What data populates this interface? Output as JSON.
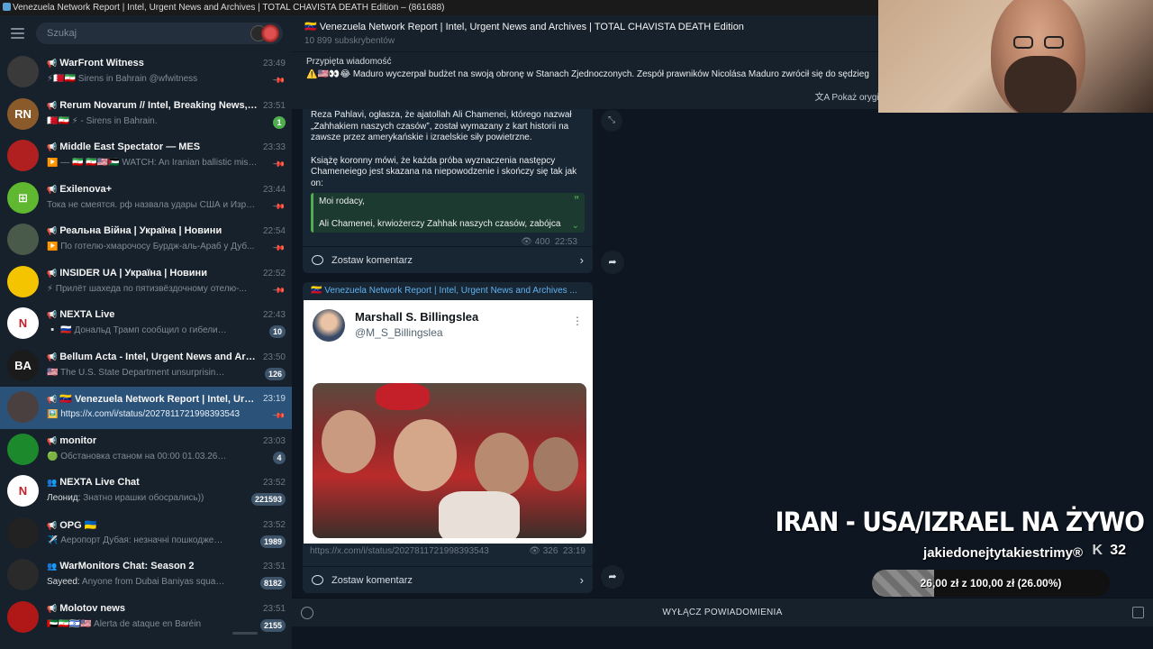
{
  "window": {
    "title": "Venezuela Network Report | Intel, Urgent News and Archives | TOTAL CHAVISTA DEATH Edition – (861688)"
  },
  "sidebar": {
    "search_placeholder": "Szukaj",
    "chats": [
      {
        "name": "WarFront Witness",
        "time": "23:49",
        "preview": "⚡🇧🇭🇮🇷 Sirens in Bahrain  @wfwitness",
        "badge": "",
        "pinned": true,
        "avatar_color": "#3a3a3a",
        "avatar_text": ""
      },
      {
        "name": "Rerum Novarum // Intel, Breaking News, and Al...",
        "time": "23:51",
        "preview": "🇧🇭🇮🇷 ⚡ - Sirens in Bahrain.",
        "badge": "1",
        "badge_green": true,
        "avatar_color": "#8b5a2b",
        "avatar_text": "RN"
      },
      {
        "name": "Middle East Spectator — MES",
        "time": "23:33",
        "preview": "▶️ — 🇮🇷 🇮🇷🇺🇸🇵🇸 WATCH: An Iranian ballistic missi...",
        "badge": "",
        "pinned": true,
        "avatar_color": "#b02020",
        "avatar_text": ""
      },
      {
        "name": "Exilenova+",
        "time": "23:44",
        "preview": "Тока не смеятся.   рф назвала удары США и Израил...",
        "badge": "",
        "pinned": true,
        "avatar_color": "#5fb82f",
        "avatar_text": "⊞"
      },
      {
        "name": "Реальна Війна | Україна | Новини",
        "time": "22:54",
        "preview": "▶️ По готелю-хмарочосу Бурдж-аль-Араб у Дуб...",
        "badge": "",
        "pinned": true,
        "avatar_color": "#4a5a4a",
        "avatar_text": ""
      },
      {
        "name": "INSIDER UA | Україна | Новини",
        "time": "22:52",
        "preview": "⚡ Прилёт шахеда по пятизвёздочному отелю-...",
        "badge": "",
        "pinned": true,
        "avatar_color": "#f5c400",
        "avatar_text": ""
      },
      {
        "name": "NEXTA Live",
        "time": "22:43",
        "preview": "▫️ 🇷🇺 Дональд Трамп сообщил о гибели верховн...",
        "badge": "10",
        "avatar_color": "#ffffff",
        "avatar_text": "N"
      },
      {
        "name": "Bellum Acta - Intel, Urgent News and Archives ...",
        "time": "23:50",
        "preview": "🇺🇸 The U.S. State Department unsurprisingly annou...",
        "badge": "126",
        "avatar_color": "#1b1b1b",
        "avatar_text": "BA"
      },
      {
        "name": "🇻🇪 Venezuela Network Report | Intel, Urgent N...",
        "time": "23:19",
        "preview": "🖼️ https://x.com/i/status/2027811721998393543",
        "badge": "",
        "pinned": true,
        "active": true,
        "avatar_color": "#4a4040",
        "avatar_text": ""
      },
      {
        "name": "monitor",
        "time": "23:03",
        "preview": "🟢 Обстановка станом на 00:00 01.03.26  — Страте...",
        "badge": "4",
        "avatar_color": "#1c8a2c",
        "avatar_text": ""
      },
      {
        "name": "NEXTA Live Chat",
        "time": "23:52",
        "preview_sender": "Леонид:",
        "preview": " Знатно ирашки обосрались))",
        "badge": "221593",
        "group": true,
        "avatar_color": "#ffffff",
        "avatar_text": "N"
      },
      {
        "name": "OPG 🇺🇦",
        "time": "23:52",
        "preview": "✈️ Аеропорт Дубая: незначні пошкодження та п...",
        "badge": "1989",
        "avatar_color": "#222222",
        "avatar_text": ""
      },
      {
        "name": "WarMonitors Chat: Season 2",
        "time": "23:51",
        "preview_sender": "Sayeed:",
        "preview": " Anyone from Dubai Baniyas square?",
        "badge": "8182",
        "group": true,
        "avatar_color": "#2a2a2a",
        "avatar_text": ""
      },
      {
        "name": "Molotov news",
        "time": "23:51",
        "preview": "🇦🇪🇮🇷🇮🇱🇺🇸 Alerta de ataque en Baréin",
        "badge": "2155",
        "avatar_color": "#b01818",
        "avatar_text": ""
      }
    ]
  },
  "header": {
    "title": "🇻🇪 Venezuela Network Report | Intel, Urgent News and Archives | TOTAL CHAVISTA DEATH Edition",
    "subscribers": "10 899 subskrybentów"
  },
  "pinned": {
    "label": "Przypięta wiadomość",
    "text": "⚠️🇺🇸👀😂 Maduro wyczerpał budżet na swoją obronę w Stanach Zjednoczonych.  Zespół prawników Nicolása Maduro zwrócił się do sędzieg"
  },
  "translate": {
    "label": "Pokaż oryginalny"
  },
  "message1": {
    "para1": "Reza Pahlavi, ogłasza, że ajatollah Ali Chamenei, którego nazwał „Zahhakiem naszych czasów”, został wymazany z kart historii na zawsze przez amerykańskie i izraelskie siły powietrzne.",
    "para2": "Książę koronny mówi, że każda próba wyznaczenia następcy Chameneiego jest skazana na niepowodzenie i skończy się tak jak on:",
    "quote_line1": "Moi rodacy,",
    "quote_line2": "Ali Chamenei, krwiożerczy Zahhak naszych czasów, zabójca",
    "views": "400",
    "time": "22:53",
    "comment_label": "Zostaw komentarz"
  },
  "message2": {
    "forwarded_from": "🇻🇪 Venezuela Network Report | Intel, Urgent News and Archives ...",
    "tweet_name": "Marshall S. Billingslea",
    "tweet_handle": "@M_S_Billingslea",
    "link": "https://x.com/i/status/2027811721998393543",
    "views": "326",
    "time": "23:19",
    "comment_label": "Zostaw komentarz"
  },
  "bottom": {
    "mute_label": "WYŁĄCZ POWIADOMIENIA"
  },
  "overlay": {
    "title": "IRAN - USA/IZRAEL NA ŻYWO",
    "username": "jakiedonejtytakiestrimy®",
    "viewers": "32",
    "goal_text": "26,00 zł z 100,00 zł (26.00%)",
    "goal_fraction": 0.26
  }
}
